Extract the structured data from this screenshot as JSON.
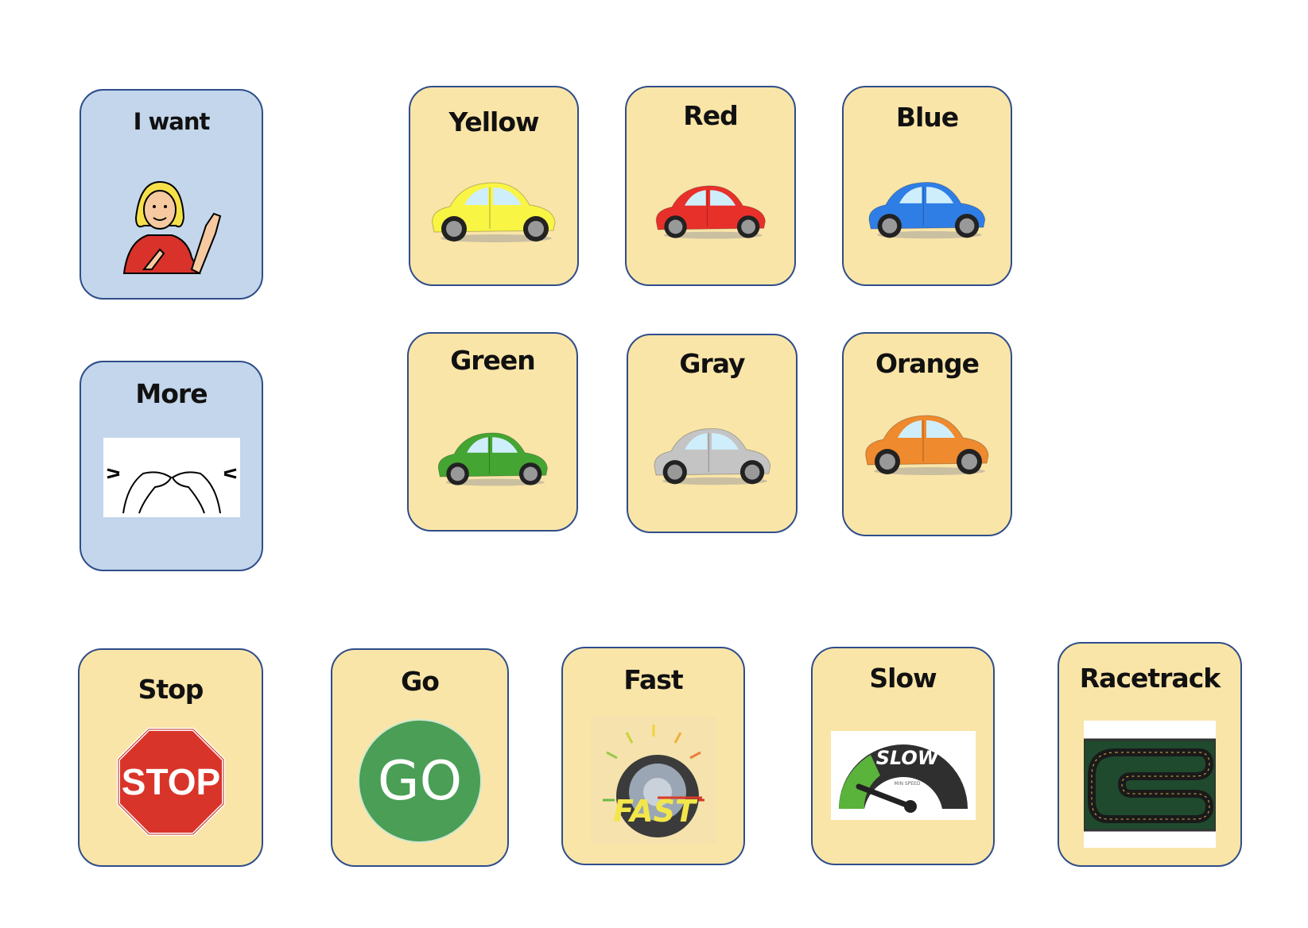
{
  "cards": {
    "i_want": {
      "label": "I want",
      "icon": "person-pointing-self-icon"
    },
    "more": {
      "label": "More",
      "icon": "sign-more-hands-icon"
    },
    "yellow": {
      "label": "Yellow",
      "icon": "car-icon",
      "color": "#f8f545"
    },
    "red": {
      "label": "Red",
      "icon": "car-icon",
      "color": "#e8302a"
    },
    "blue": {
      "label": "Blue",
      "icon": "car-icon",
      "color": "#2f7ee6"
    },
    "green": {
      "label": "Green",
      "icon": "car-icon",
      "color": "#44a532"
    },
    "gray": {
      "label": "Gray",
      "icon": "car-icon",
      "color": "#c4c4c4"
    },
    "orange": {
      "label": "Orange",
      "icon": "car-icon",
      "color": "#ef8a2e"
    },
    "stop": {
      "label": "Stop",
      "icon": "stop-sign-icon",
      "sign_text": "STOP"
    },
    "go": {
      "label": "Go",
      "icon": "go-circle-icon",
      "sign_text": "GO"
    },
    "fast": {
      "label": "Fast",
      "icon": "fast-speedometer-icon",
      "sign_text": "FAST"
    },
    "slow": {
      "label": "Slow",
      "icon": "slow-gauge-icon",
      "sign_text": "SLOW",
      "sub_text": "MIN SPEED"
    },
    "racetrack": {
      "label": "Racetrack",
      "icon": "racetrack-icon"
    }
  },
  "colors": {
    "card_blue": "#c3d6eb",
    "card_yellow": "#fae5a8",
    "border": "#2f4d8a"
  }
}
